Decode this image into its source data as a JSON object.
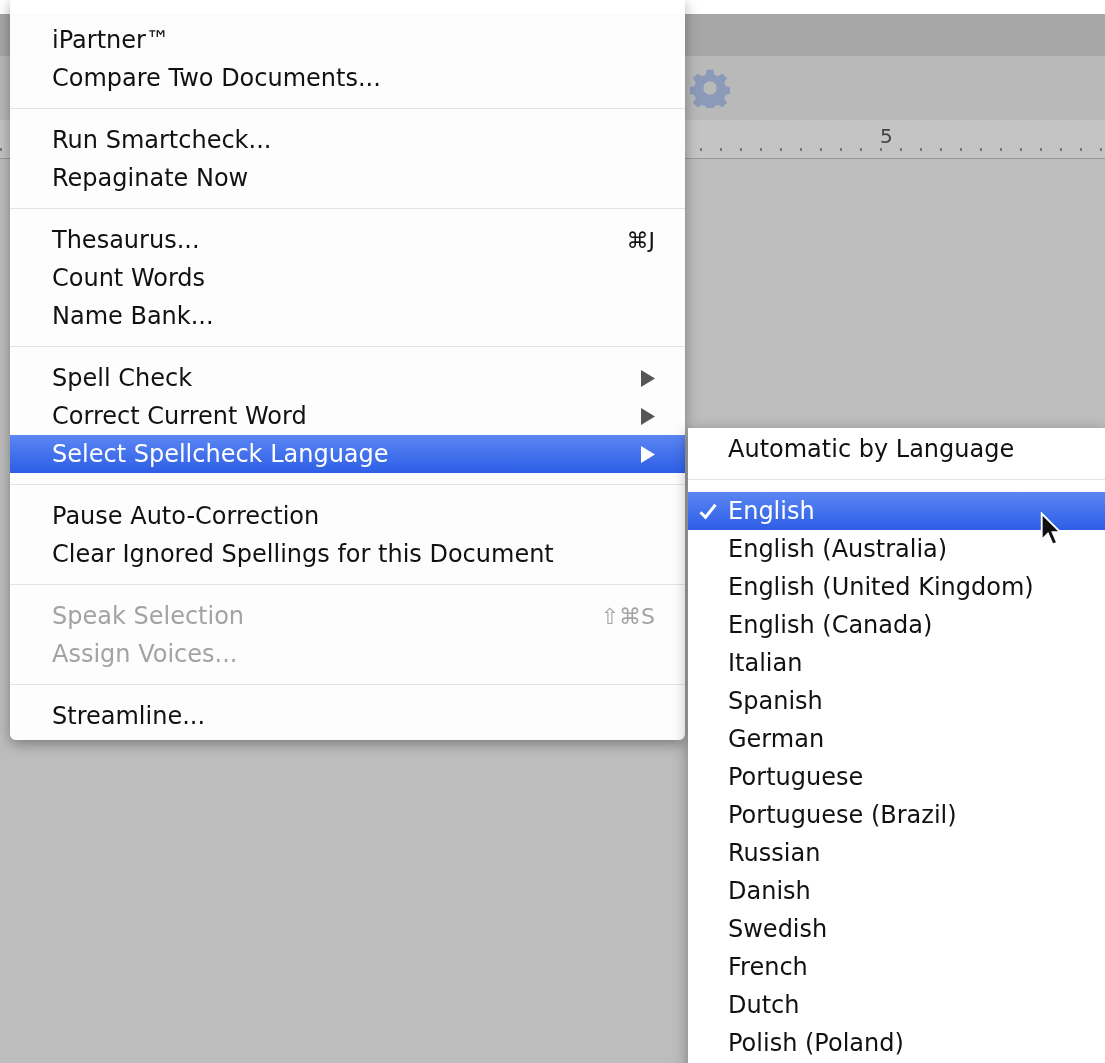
{
  "document_window": {
    "ruler_label": "5"
  },
  "menu": {
    "sections": [
      [
        {
          "label": "iPartner™",
          "submenu": false,
          "disabled": false,
          "selected": false
        },
        {
          "label": "Compare Two Documents...",
          "submenu": false,
          "disabled": false,
          "selected": false
        }
      ],
      [
        {
          "label": "Run Smartcheck...",
          "submenu": false,
          "disabled": false,
          "selected": false
        },
        {
          "label": "Repaginate Now",
          "submenu": false,
          "disabled": false,
          "selected": false
        }
      ],
      [
        {
          "label": "Thesaurus...",
          "shortcut": "⌘J",
          "submenu": false,
          "disabled": false,
          "selected": false
        },
        {
          "label": "Count Words",
          "submenu": false,
          "disabled": false,
          "selected": false
        },
        {
          "label": "Name Bank...",
          "submenu": false,
          "disabled": false,
          "selected": false
        }
      ],
      [
        {
          "label": "Spell Check",
          "submenu": true,
          "disabled": false,
          "selected": false
        },
        {
          "label": "Correct Current Word",
          "submenu": true,
          "disabled": false,
          "selected": false
        },
        {
          "label": "Select Spellcheck Language",
          "submenu": true,
          "disabled": false,
          "selected": true
        }
      ],
      [
        {
          "label": "Pause Auto-Correction",
          "submenu": false,
          "disabled": false,
          "selected": false
        },
        {
          "label": "Clear Ignored Spellings for this Document",
          "submenu": false,
          "disabled": false,
          "selected": false
        }
      ],
      [
        {
          "label": "Speak Selection",
          "shortcut": "⇧⌘S",
          "submenu": false,
          "disabled": true,
          "selected": false
        },
        {
          "label": "Assign Voices...",
          "submenu": false,
          "disabled": true,
          "selected": false
        }
      ],
      [
        {
          "label": "Streamline...",
          "submenu": false,
          "disabled": false,
          "selected": false
        }
      ]
    ]
  },
  "submenu": {
    "sections": [
      [
        {
          "label": "Automatic by Language",
          "checked": false,
          "selected": false
        }
      ],
      [
        {
          "label": "English",
          "checked": true,
          "selected": true
        },
        {
          "label": "English (Australia)",
          "checked": false,
          "selected": false
        },
        {
          "label": "English (United Kingdom)",
          "checked": false,
          "selected": false
        },
        {
          "label": "English (Canada)",
          "checked": false,
          "selected": false
        },
        {
          "label": "Italian",
          "checked": false,
          "selected": false
        },
        {
          "label": "Spanish",
          "checked": false,
          "selected": false
        },
        {
          "label": "German",
          "checked": false,
          "selected": false
        },
        {
          "label": "Portuguese",
          "checked": false,
          "selected": false
        },
        {
          "label": "Portuguese (Brazil)",
          "checked": false,
          "selected": false
        },
        {
          "label": "Russian",
          "checked": false,
          "selected": false
        },
        {
          "label": "Danish",
          "checked": false,
          "selected": false
        },
        {
          "label": "Swedish",
          "checked": false,
          "selected": false
        },
        {
          "label": "French",
          "checked": false,
          "selected": false
        },
        {
          "label": "Dutch",
          "checked": false,
          "selected": false
        },
        {
          "label": "Polish (Poland)",
          "checked": false,
          "selected": false
        }
      ]
    ]
  }
}
